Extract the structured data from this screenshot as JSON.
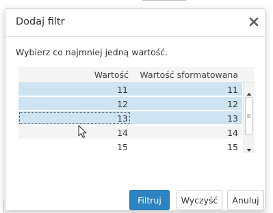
{
  "dialog": {
    "title": "Dodaj filtr",
    "close_icon": "close-icon",
    "prompt": "Wybierz co najmniej jedną wartość."
  },
  "grid": {
    "columns": [
      "Wartość",
      "Wartość sformatowana"
    ],
    "rows": [
      {
        "value": "11",
        "formatted": "11",
        "selected": true
      },
      {
        "value": "12",
        "formatted": "12",
        "selected": true
      },
      {
        "value": "13",
        "formatted": "13",
        "selected": true,
        "focused": true
      },
      {
        "value": "14",
        "formatted": "14",
        "selected": false
      },
      {
        "value": "15",
        "formatted": "15",
        "selected": false
      }
    ]
  },
  "buttons": {
    "filter": "Filtruj",
    "clear": "Wyczyść",
    "cancel": "Anuluj"
  },
  "colors": {
    "selected_row": "#cfe4f3",
    "primary_button": "#2e83c2"
  },
  "icons": {
    "scroll_up": "scroll-up-arrow-icon",
    "scroll_down": "scroll-down-arrow-icon",
    "cursor": "mouse-pointer-icon"
  }
}
